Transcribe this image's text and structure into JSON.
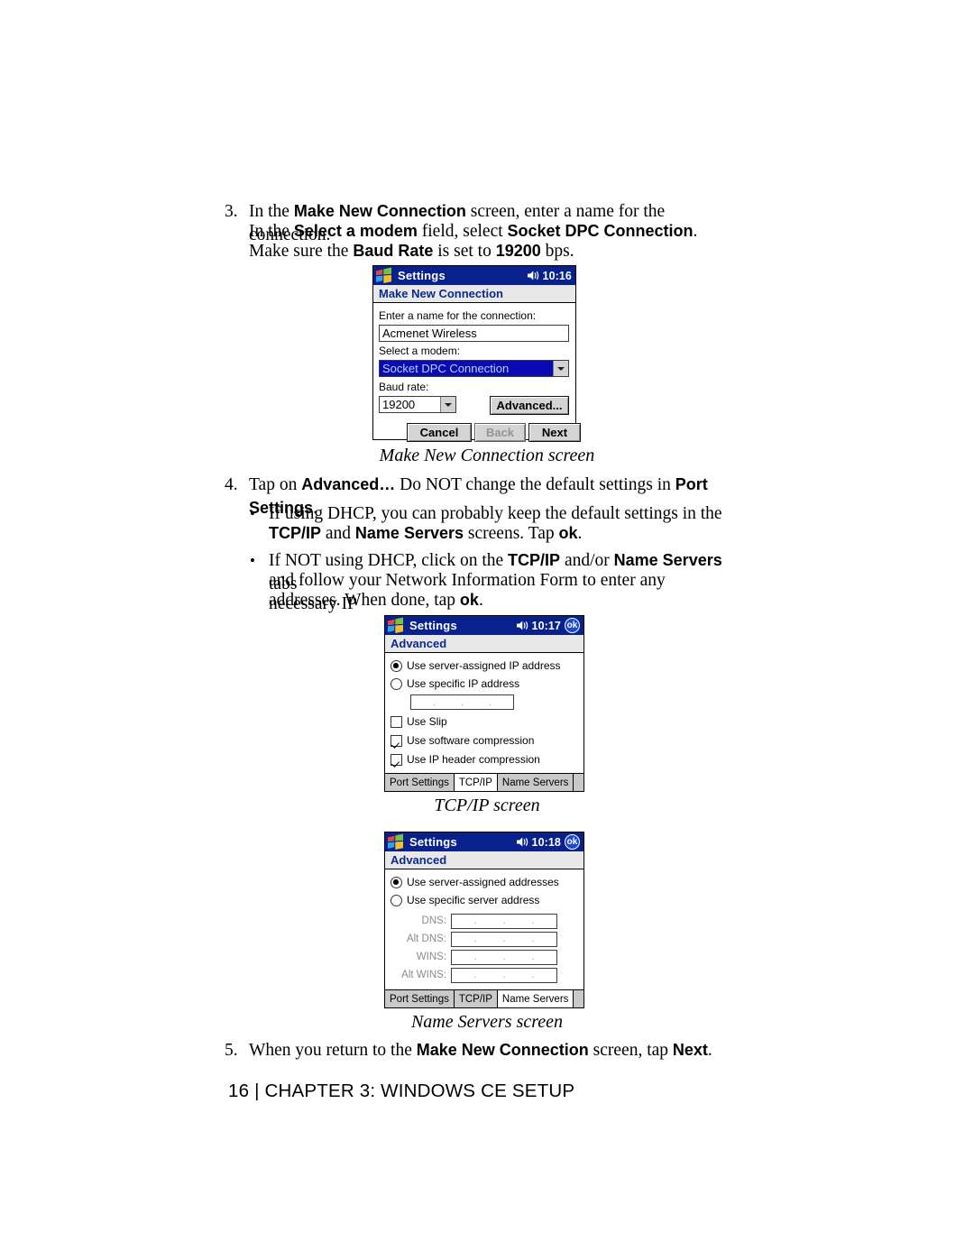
{
  "document": {
    "footer": "16 | CHAPTER 3: WINDOWS CE SETUP"
  },
  "steps": [
    {
      "number": "3.",
      "lines": [
        "In the <b>Make New Connection</b> screen, enter a name for the connection.",
        "In the <b>Select a modem</b> field, select <b>Socket DPC Connection</b>.",
        "Make sure the <b>Baud Rate</b> is set to <b>19200</b> bps."
      ]
    },
    {
      "number": "4.",
      "lines": [
        "Tap on <b>Advanced…</b> Do NOT change the default settings in <b>Port Settings</b>."
      ],
      "bullets": [
        [
          "If using DHCP, you can probably keep the default settings in the",
          "<b>TCP/IP</b> and <b>Name Servers</b> screens. Tap <b>ok</b>."
        ],
        [
          "If NOT using DHCP, click on the <b>TCP/IP</b> and/or <b>Name Servers</b> tabs",
          "and follow your Network Information Form to enter any necessary IP",
          "addresses. When done, tap <b>ok</b>."
        ]
      ]
    },
    {
      "number": "5.",
      "lines": [
        "When you return to the <b>Make New Connection</b> screen, tap <b>Next</b>."
      ]
    }
  ],
  "captions": {
    "make_new_connection": "Make New Connection screen",
    "tcpip": "TCP/IP screen",
    "name_servers": "Name Servers screen"
  },
  "screens": {
    "make_new_connection": {
      "titlebar": {
        "app_title": "Settings",
        "clock": "10:16",
        "speaker_icon": "speaker-icon",
        "windows_logo_icon": "windows-flag-icon"
      },
      "subtitle": "Make New Connection",
      "name_label": "Enter a name for the connection:",
      "name_value": "Acmenet Wireless",
      "modem_label": "Select a modem:",
      "modem_value": "Socket DPC Connection",
      "baud_label": "Baud rate:",
      "baud_value": "19200",
      "advanced_button": "Advanced...",
      "cancel_button": "Cancel",
      "back_button": "Back",
      "next_button": "Next"
    },
    "tcpip": {
      "titlebar": {
        "app_title": "Settings",
        "clock": "10:17",
        "ok_button": "ok",
        "speaker_icon": "speaker-icon",
        "windows_logo_icon": "windows-flag-icon"
      },
      "subtitle": "Advanced",
      "options": [
        {
          "type": "radio",
          "checked": true,
          "label": "Use server-assigned IP address"
        },
        {
          "type": "radio",
          "checked": false,
          "label": "Use specific IP address"
        }
      ],
      "ip_field_value": "",
      "checkboxes": [
        {
          "checked": false,
          "label": "Use Slip"
        },
        {
          "checked": true,
          "label": "Use software compression"
        },
        {
          "checked": true,
          "label": "Use IP header compression"
        }
      ],
      "tabs": [
        {
          "label": "Port Settings",
          "active": false
        },
        {
          "label": "TCP/IP",
          "active": true
        },
        {
          "label": "Name Servers",
          "active": false
        }
      ]
    },
    "name_servers": {
      "titlebar": {
        "app_title": "Settings",
        "clock": "10:18",
        "ok_button": "ok",
        "speaker_icon": "speaker-icon",
        "windows_logo_icon": "windows-flag-icon"
      },
      "subtitle": "Advanced",
      "options": [
        {
          "type": "radio",
          "checked": true,
          "label": "Use server-assigned addresses"
        },
        {
          "type": "radio",
          "checked": false,
          "label": "Use specific server address"
        }
      ],
      "fields": [
        {
          "label": "DNS:",
          "value": ""
        },
        {
          "label": "Alt DNS:",
          "value": ""
        },
        {
          "label": "WINS:",
          "value": ""
        },
        {
          "label": "Alt WINS:",
          "value": ""
        }
      ],
      "tabs": [
        {
          "label": "Port Settings",
          "active": false
        },
        {
          "label": "TCP/IP",
          "active": false
        },
        {
          "label": "Name Servers",
          "active": true
        }
      ]
    }
  },
  "colors": {
    "titlebar": "#08218c",
    "subtitle_text": "#0b2a8f",
    "selection": "#0a0ab4",
    "ok_button": "#1b4ad0"
  }
}
